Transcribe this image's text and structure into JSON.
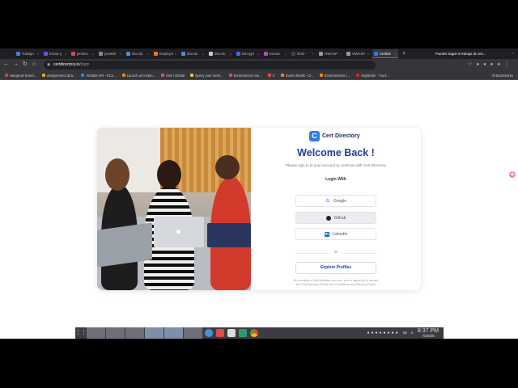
{
  "browser": {
    "tabs": [
      {
        "label": "Trabajo",
        "color": "#4a7bd4"
      },
      {
        "label": "Entrar y",
        "color": "#7a4bd4"
      },
      {
        "label": "jenkins",
        "color": "#d44a4a"
      },
      {
        "label": "jose68/",
        "color": "#888888"
      },
      {
        "label": "dso-do",
        "color": "#4a90d4"
      },
      {
        "label": "Deploym",
        "color": "#e07a2e"
      },
      {
        "label": "dso-do",
        "color": "#4a90d4"
      },
      {
        "label": "dso-do",
        "color": "#cccccc"
      },
      {
        "label": "Encrypt",
        "color": "#3b6fd4"
      },
      {
        "label": "Kestra",
        "color": "#9b59b6"
      },
      {
        "label": "NVD - ",
        "color": "#444444"
      },
      {
        "label": "OWASP",
        "color": "#999999"
      },
      {
        "label": "OWASP",
        "color": "#999999"
      },
      {
        "label": "CertDir",
        "color": "#2f7be0",
        "active": true
      }
    ],
    "new_tab": "+",
    "notification": "Puedes seguir el trabajo de Jes...",
    "url_host": "certdirectory.io",
    "url_path": "/login",
    "bookmarks": [
      {
        "label": "Haegeuls brand...",
        "color": "#e03a3a"
      },
      {
        "label": "assignment2.dira...",
        "color": "#f0a020"
      },
      {
        "label": "Airtable API - EC2...",
        "color": "#2d7ff9"
      },
      {
        "label": "Launch an instan...",
        "color": "#f08020"
      },
      {
        "label": "IAM | Global",
        "color": "#e05050"
      },
      {
        "label": "Query your metri...",
        "color": "#f0c040"
      },
      {
        "label": "Environment ove...",
        "color": "#e05050"
      },
      {
        "label": "C",
        "color": "#e05050"
      },
      {
        "label": "Event details - Cl...",
        "color": "#f08020"
      },
      {
        "label": "Environments | ...",
        "color": "#f08020"
      },
      {
        "label": "Nightrider - YouT...",
        "color": "#e02020"
      }
    ],
    "all_bookmarks": "All Bookmarks"
  },
  "login": {
    "brand_logo": "C",
    "brand_name": "Cert Directory",
    "title": "Welcome Back !",
    "subtitle": "Please sign in to your account to continue with Cert Directory",
    "login_with": "Login With",
    "google": "Google",
    "github": "Github",
    "linkedin": "LinkedIn",
    "or": "or",
    "explore": "Explore Profiles",
    "terms": "By creating a CertDirectory account, you're agreeing to accept the CertDirectory Terms and Conditions and Privacy Policy"
  },
  "taskbar": {
    "time": "8:37 PM",
    "date": "7/26/26",
    "lang": "us"
  }
}
